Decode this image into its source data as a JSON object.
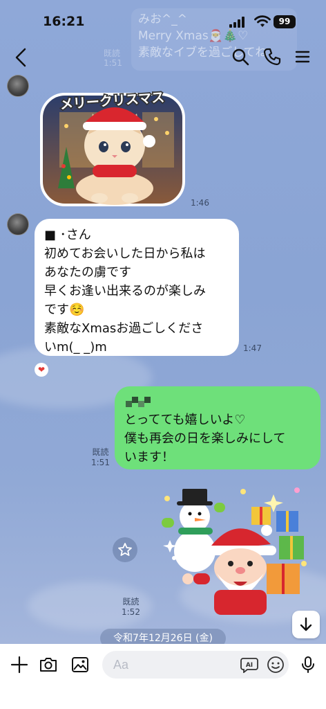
{
  "status_bar": {
    "time": "16:21",
    "battery": "99"
  },
  "notification_preview": {
    "lines": [
      "みお^_^",
      "Merry Xmas🎅🎄♡",
      "素敵なイブを過ごしてね"
    ]
  },
  "header": {
    "read_ghost": [
      "既読",
      "1:51"
    ]
  },
  "messages": [
    {
      "side": "incoming",
      "type": "sticker",
      "sticker": "merry-christmas-kitten",
      "sticker_text": "メリークリスマス",
      "time": "1:46"
    },
    {
      "side": "incoming",
      "type": "text",
      "lines": [
        "■ ･さん",
        "初めてお会いした日から私は",
        "あなたの虜です",
        "早くお逢い出来るのが楽しみ",
        "です☺️",
        "素敵なXmasお過ごしくださ",
        "いm(_ _)m"
      ],
      "time": "1:47",
      "reaction": "❤"
    },
    {
      "side": "outgoing",
      "type": "text",
      "lines": [
        "",
        "とってても嬉しいよ♡",
        "僕も再会の日を楽しみにして",
        "います！"
      ],
      "read_label": "既読",
      "time": "1:51"
    },
    {
      "side": "outgoing",
      "type": "sticker",
      "sticker": "santa-snowman-presents",
      "read_label": "既読",
      "time": "1:52"
    }
  ],
  "date_separator": "令和7年12月26日 (金)",
  "input": {
    "placeholder": "Aa",
    "ai_label": "AI"
  },
  "colors": {
    "chat_background": "#8CA6D6",
    "outgoing_bubble": "#6EE07A",
    "incoming_bubble": "#FFFFFF"
  }
}
